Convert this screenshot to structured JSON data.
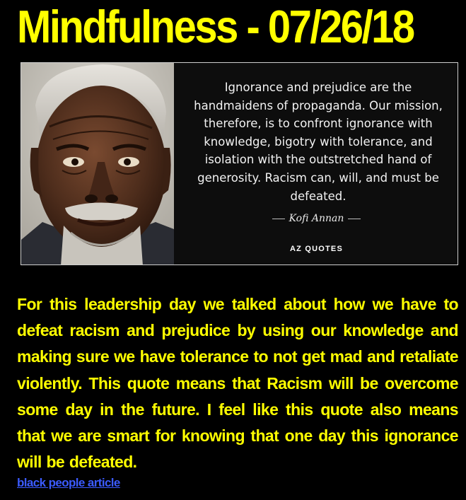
{
  "header": {
    "title": "Mindfulness - 07/26/18"
  },
  "quote_card": {
    "quote": "Ignorance and prejudice are the handmaidens of propaganda. Our mission, therefore, is to confront ignorance with knowledge, bigotry with tolerance, and isolation with the outstretched hand of generosity. Racism can, will, and must be defeated.",
    "author": "Kofi Annan",
    "brand": "AZ QUOTES"
  },
  "article": {
    "paragraph": "For this leadership day we talked about how we have to defeat racism and prejudice by using our knowledge and making sure we have tolerance to  not get mad and retaliate violently. This quote means that Racism will be overcome some day in the future. I feel like this quote also means that we are smart for knowing that one day this ignorance will be defeated.",
    "link_label": "black people article"
  },
  "colors": {
    "background": "#000000",
    "title": "#ffff00",
    "body_text": "#ffff00",
    "link": "#3b5bff"
  }
}
